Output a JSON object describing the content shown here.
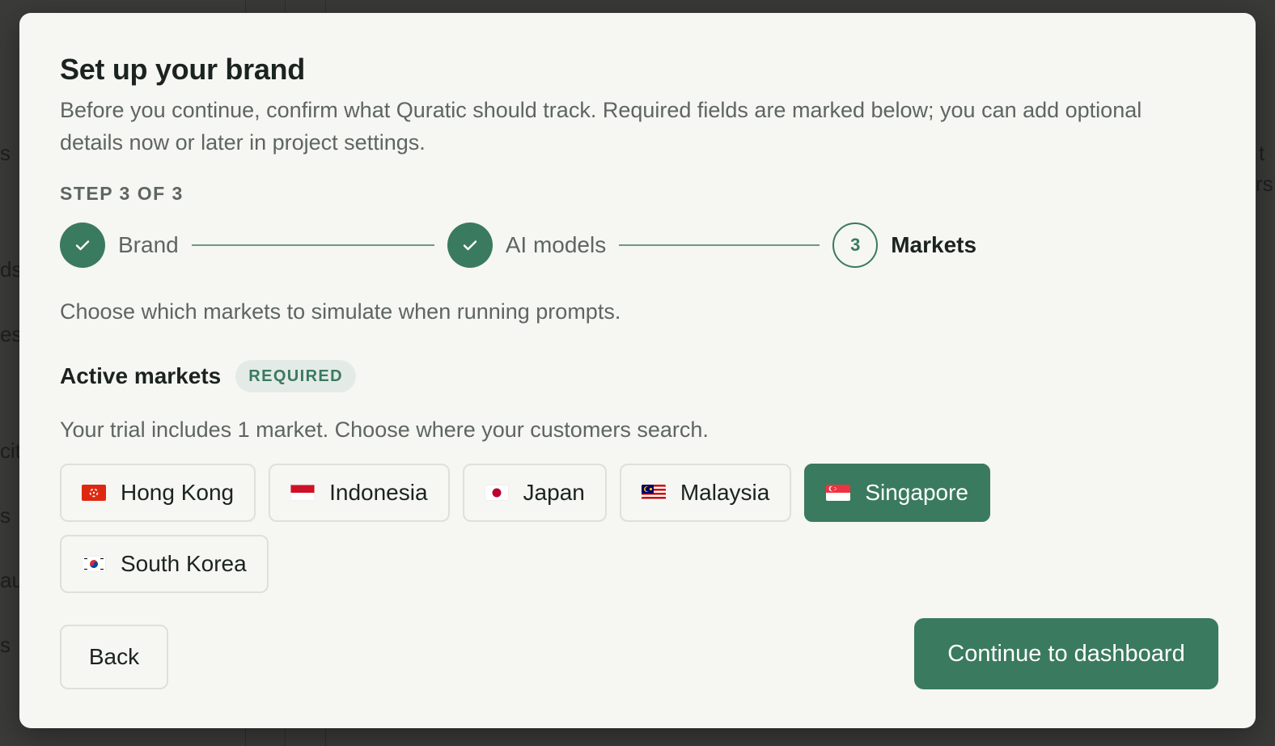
{
  "background": {
    "fragments": [
      "s",
      "ds",
      "es",
      "cit",
      "s",
      "au",
      "s",
      "t",
      "rs"
    ]
  },
  "modal": {
    "title": "Set up your brand",
    "subtitle": "Before you continue, confirm what Quratic should track. Required fields are marked below; you can add optional details now or later in project settings.",
    "step_label": "STEP 3 OF 3",
    "steps": [
      {
        "label": "Brand",
        "state": "done"
      },
      {
        "label": "AI models",
        "state": "done"
      },
      {
        "label": "Markets",
        "state": "current",
        "number": "3"
      }
    ],
    "section_desc": "Choose which markets to simulate when running prompts.",
    "field_label": "Active markets",
    "required_badge": "REQUIRED",
    "helper": "Your trial includes 1 market. Choose where your customers search.",
    "markets": [
      {
        "label": "Hong Kong",
        "flag": "hk-flag-icon",
        "selected": false
      },
      {
        "label": "Indonesia",
        "flag": "id-flag-icon",
        "selected": false
      },
      {
        "label": "Japan",
        "flag": "jp-flag-icon",
        "selected": false
      },
      {
        "label": "Malaysia",
        "flag": "my-flag-icon",
        "selected": false
      },
      {
        "label": "Singapore",
        "flag": "sg-flag-icon",
        "selected": true
      },
      {
        "label": "South Korea",
        "flag": "kr-flag-icon",
        "selected": false
      }
    ],
    "back_label": "Back",
    "continue_label": "Continue to dashboard"
  },
  "colors": {
    "accent": "#3a7a5e",
    "modal_bg": "#f6f6f2",
    "text_primary": "#1b2320",
    "text_secondary": "#5e6562"
  }
}
